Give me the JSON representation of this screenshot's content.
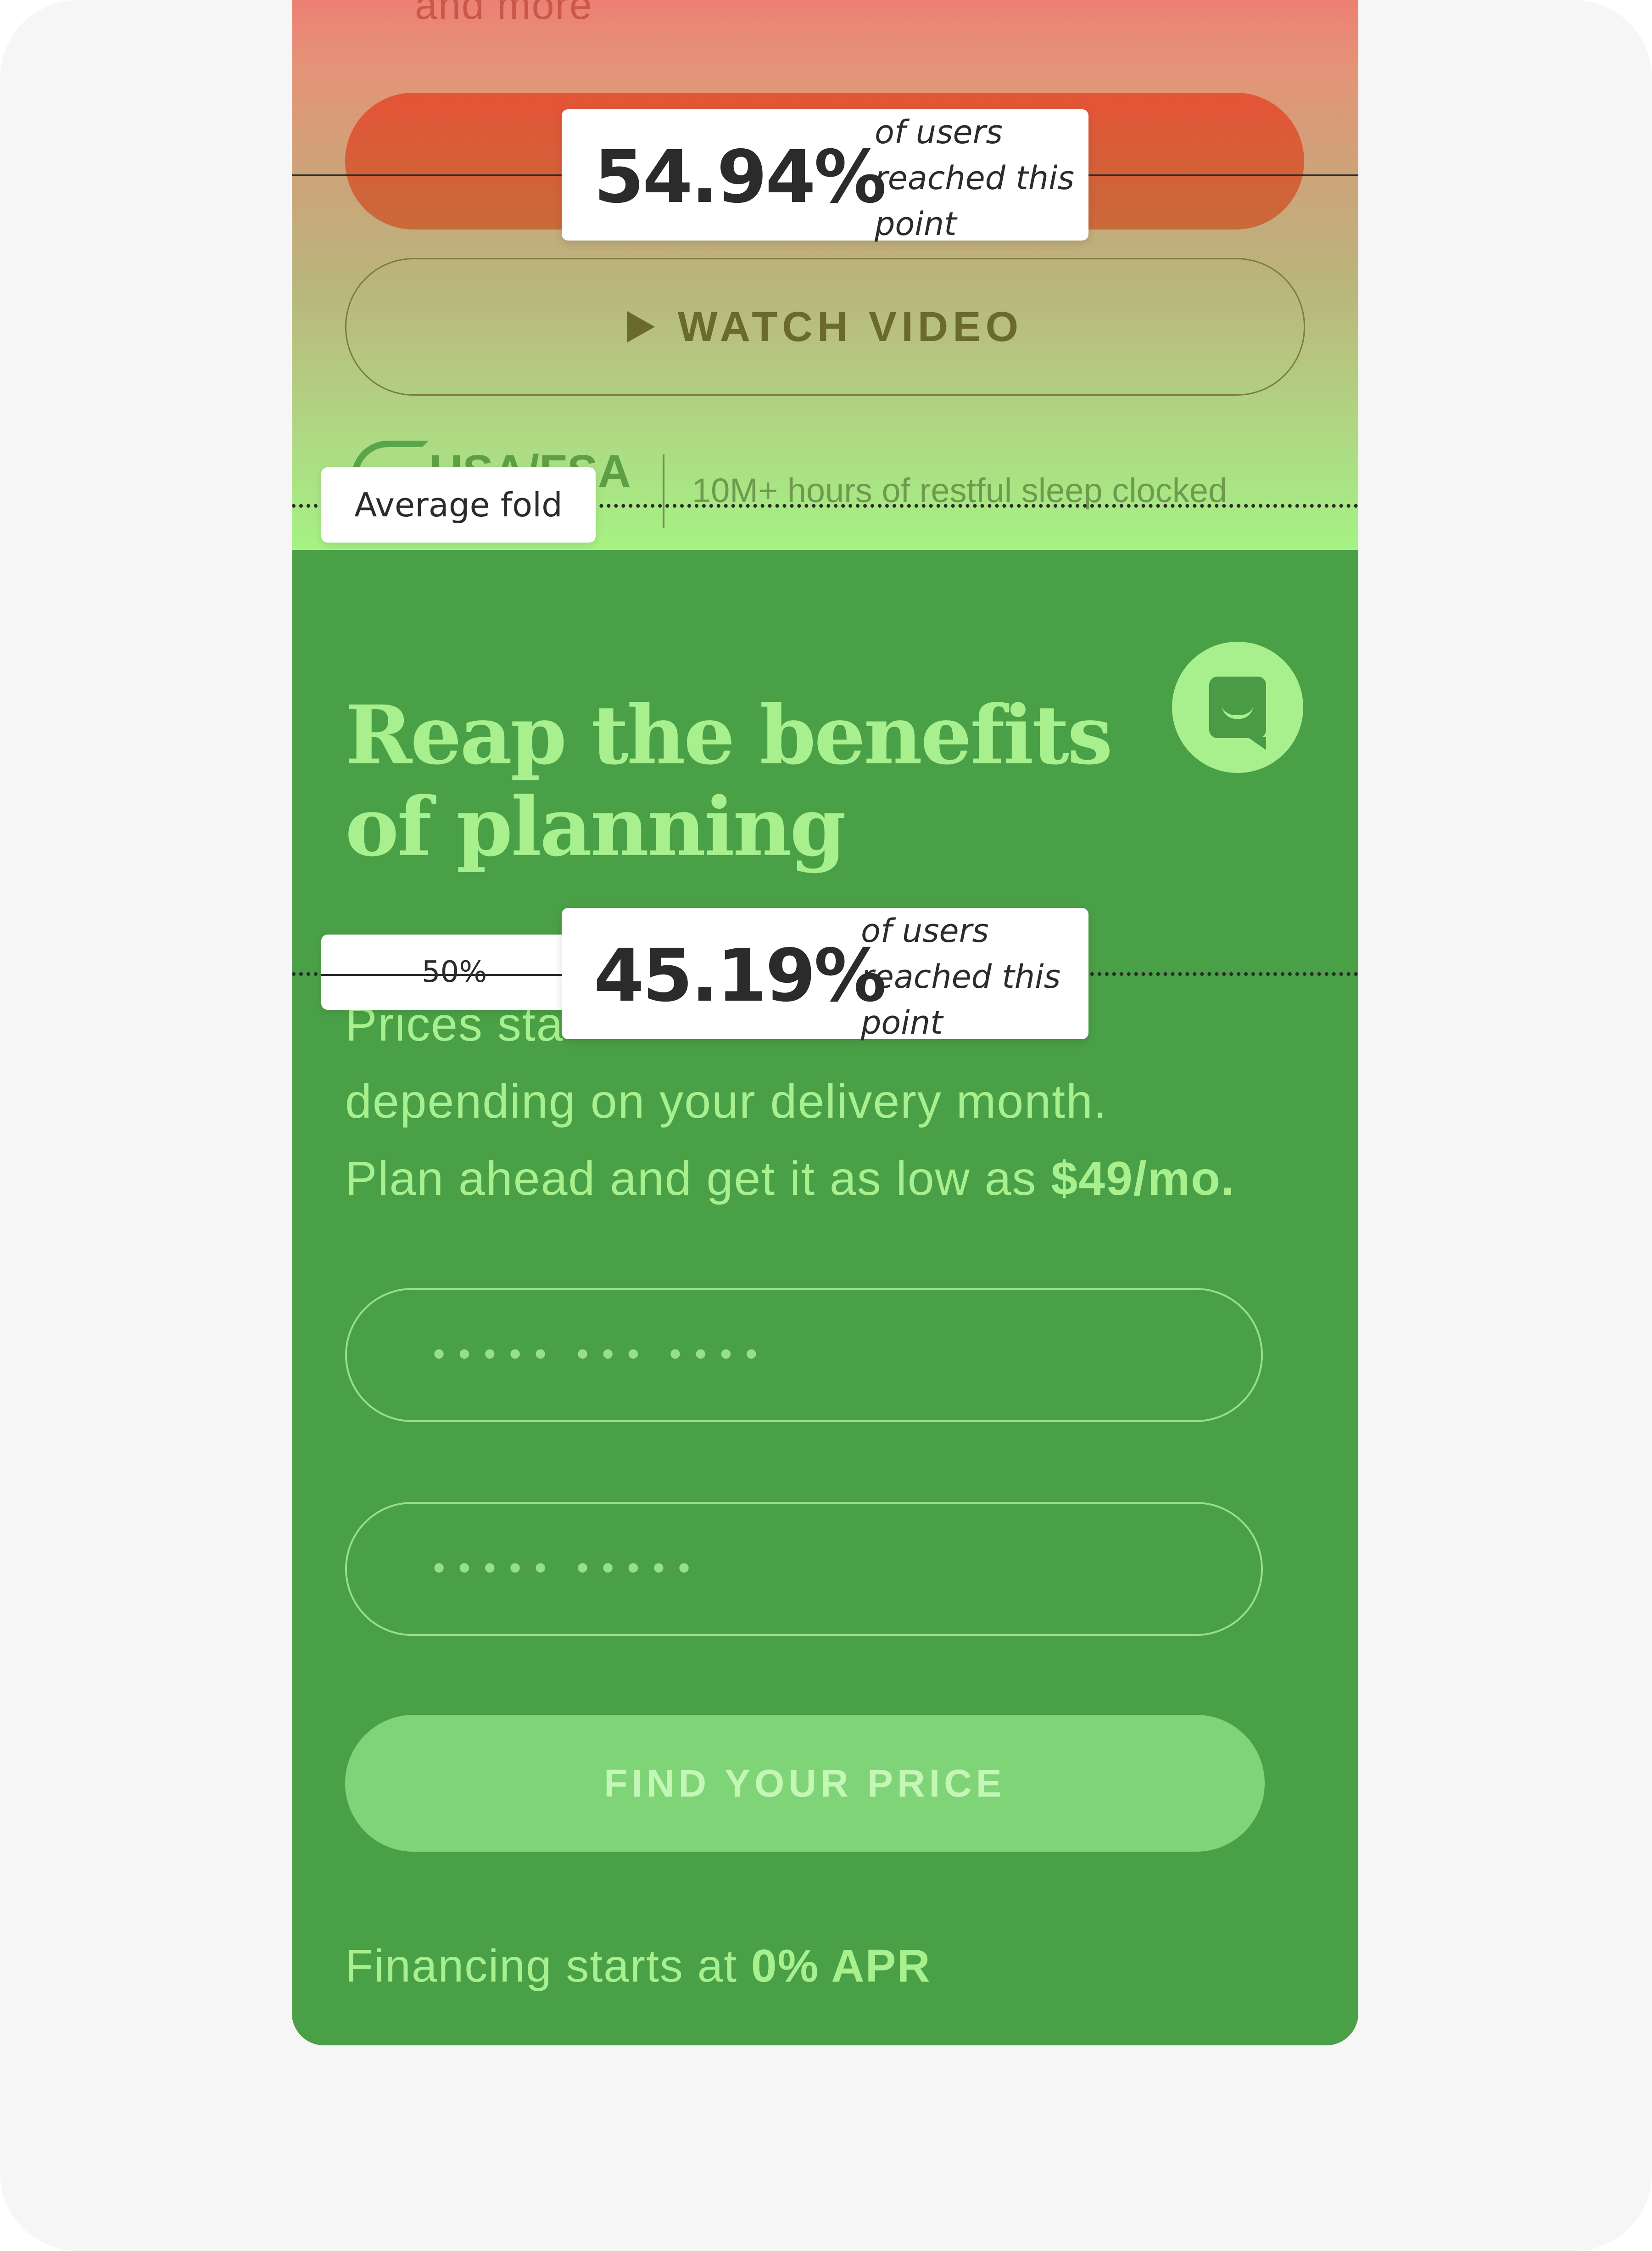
{
  "hero": {
    "partial_text": "and more",
    "watch_video_label": "WATCH VIDEO",
    "badge_text": "USA/FSA",
    "sleep_text": "10M+ hours of restful sleep clocked"
  },
  "section": {
    "heading_line1": "Reap the benefits",
    "heading_line2": "of planning",
    "body_prefix": "Prices sta",
    "body_line2": "depending on your delivery month.",
    "body_line3_prefix": "Plan ahead and get it as low as ",
    "body_line3_bold": "$49/mo.",
    "phone_placeholder": "••••• ••• ••••",
    "zip_placeholder": "••••• •••••",
    "cta_label": "FIND YOUR PRICE",
    "financing_prefix": "Financing starts at ",
    "financing_bold": "0% APR"
  },
  "overlays": {
    "reach_top": {
      "value": "54.94%",
      "caption_line1": "of users",
      "caption_line2": "reached this",
      "caption_line3": "point"
    },
    "reach_mid": {
      "value": "45.19%",
      "caption_line1": "of users",
      "caption_line2": "reached this",
      "caption_line3": "point"
    },
    "fold_label": "Average fold",
    "percent_marker": "50%"
  },
  "icons": {
    "play": "play-icon",
    "chat": "chat-icon",
    "badge_logo": "badge-logo-icon"
  },
  "colors": {
    "heat_top": "#ec8073",
    "heat_bottom": "#a6f284",
    "section_bg": "#4aa047",
    "accent_text": "#a8f08e",
    "cta_bg": "#80d478"
  }
}
